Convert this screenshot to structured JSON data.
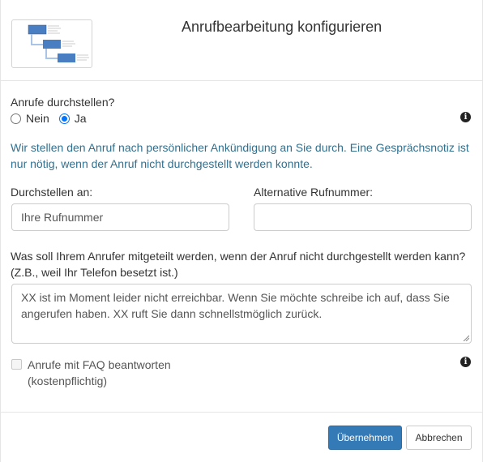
{
  "dialog": {
    "title": "Anrufbearbeitung konfigurieren"
  },
  "transfer_question": {
    "label": "Anrufe durchstellen?",
    "options": [
      {
        "label": "Nein",
        "selected": false
      },
      {
        "label": "Ja",
        "selected": true
      }
    ]
  },
  "info_text": "Wir stellen den Anruf nach persönlicher Ankündigung an Sie durch. Eine Gesprächsnotiz ist nur nötig, wenn der Anruf nicht durchgestellt werden konnte.",
  "transfer_to": {
    "label": "Durchstellen an:",
    "value": "Ihre Rufnummer"
  },
  "alt_number": {
    "label": "Alternative Rufnummer:",
    "value": ""
  },
  "message": {
    "label": "Was soll Ihrem Anrufer mitgeteilt werden, wenn der Anruf nicht durchgestellt werden kann? (Z.B., weil Ihr Telefon besetzt ist.)",
    "value": "XX ist im Moment leider nicht erreichbar. Wenn Sie möchte schreibe ich auf, dass Sie angerufen haben. XX ruft Sie dann schnellstmöglich zurück."
  },
  "faq": {
    "line1": "Anrufe mit FAQ beantworten",
    "line2": "(kostenpflichtig)",
    "checked": false
  },
  "buttons": {
    "apply": "Übernehmen",
    "cancel": "Abbrechen"
  },
  "icons": {
    "info": "info-circle-icon",
    "diagram_thumbnail": "flow-diagram-thumbnail"
  },
  "colors": {
    "primary": "#337ab7",
    "info_text": "#31708f",
    "radio_checked": "#0075ff"
  }
}
